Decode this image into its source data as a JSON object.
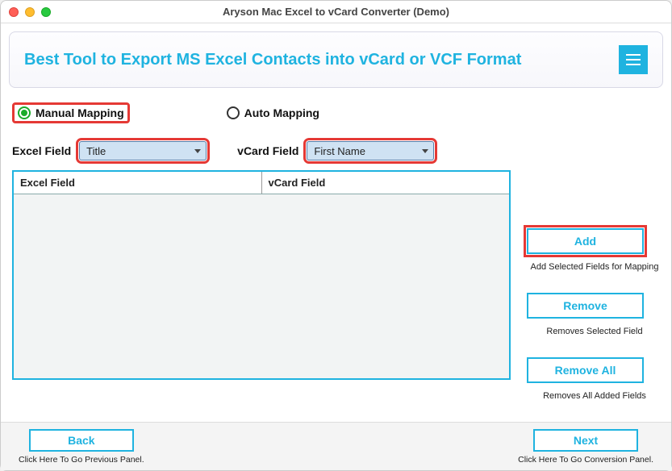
{
  "window": {
    "title": "Aryson Mac Excel to vCard Converter (Demo)"
  },
  "header": {
    "title": "Best Tool to Export MS Excel Contacts into vCard or VCF Format"
  },
  "mapping": {
    "manual_label": "Manual Mapping",
    "auto_label": "Auto Mapping",
    "selected": "manual",
    "excel_field_label": "Excel Field",
    "vcard_field_label": "vCard Field",
    "excel_field_value": "Title",
    "vcard_field_value": "First Name"
  },
  "table": {
    "col_excel": "Excel Field",
    "col_vcard": "vCard Field",
    "rows": []
  },
  "actions": {
    "add": "Add",
    "add_hint": "Add Selected Fields for Mapping",
    "remove": "Remove",
    "remove_hint": "Removes Selected Field",
    "remove_all": "Remove All",
    "remove_all_hint": "Removes All Added Fields"
  },
  "footer": {
    "back": "Back",
    "back_hint": "Click Here To Go Previous Panel.",
    "next": "Next",
    "next_hint": "Click Here To Go Conversion Panel."
  }
}
